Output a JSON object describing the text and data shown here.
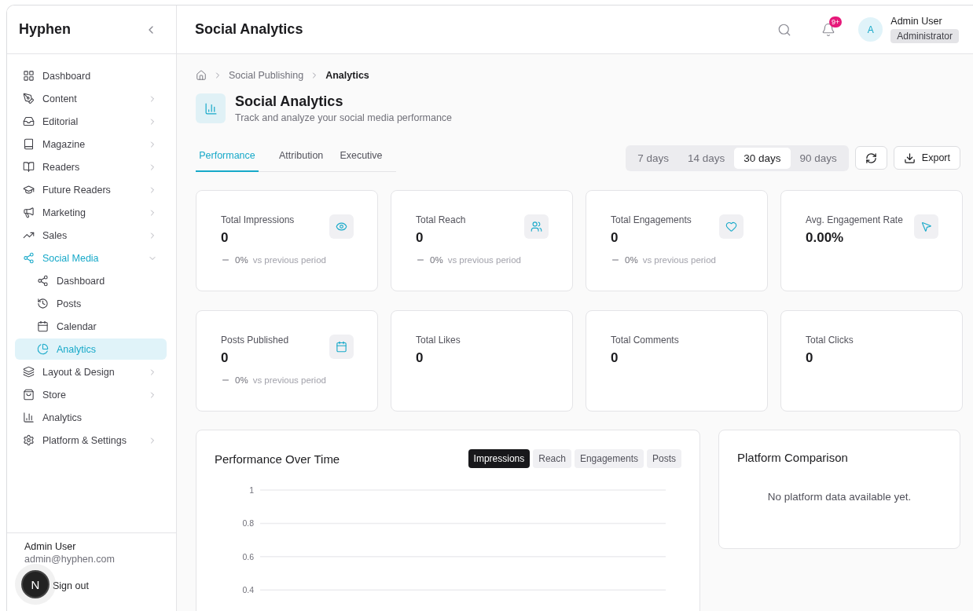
{
  "sidebar": {
    "brand": "Hyphen",
    "items": [
      {
        "label": "Dashboard",
        "expandable": false,
        "selected": false
      },
      {
        "label": "Content",
        "expandable": true,
        "expanded": false,
        "selected": false
      },
      {
        "label": "Editorial",
        "expandable": true,
        "expanded": false,
        "selected": false
      },
      {
        "label": "Magazine",
        "expandable": true,
        "expanded": false,
        "selected": false
      },
      {
        "label": "Readers",
        "expandable": true,
        "expanded": false,
        "selected": false
      },
      {
        "label": "Future Readers",
        "expandable": true,
        "expanded": false,
        "selected": false
      },
      {
        "label": "Marketing",
        "expandable": true,
        "expanded": false,
        "selected": false
      },
      {
        "label": "Sales",
        "expandable": true,
        "expanded": false,
        "selected": false
      },
      {
        "label": "Social Media",
        "expandable": true,
        "expanded": true,
        "selected": false,
        "children": [
          {
            "label": "Dashboard",
            "selected": false
          },
          {
            "label": "Posts",
            "selected": false
          },
          {
            "label": "Calendar",
            "selected": false
          },
          {
            "label": "Analytics",
            "selected": true
          }
        ]
      },
      {
        "label": "Layout & Design",
        "expandable": true,
        "expanded": false,
        "selected": false
      },
      {
        "label": "Store",
        "expandable": true,
        "expanded": false,
        "selected": false
      },
      {
        "label": "Analytics",
        "expandable": false,
        "selected": false
      },
      {
        "label": "Platform & Settings",
        "expandable": true,
        "expanded": false,
        "selected": false
      }
    ],
    "user": {
      "name": "Admin User",
      "email": "admin@hyphen.com",
      "sign_out": "Sign out"
    }
  },
  "dev_badge": {
    "label": "N"
  },
  "header": {
    "title": "Social Analytics",
    "notification_badge": "9+",
    "avatar": "A",
    "user_name": "Admin User",
    "role": "Administrator"
  },
  "breadcrumbs": [
    "Social Publishing",
    "Analytics"
  ],
  "page": {
    "title": "Social Analytics",
    "subtitle": "Track and analyze your social media performance"
  },
  "tabs": [
    {
      "label": "Performance",
      "selected": true
    },
    {
      "label": "Attribution",
      "selected": false
    },
    {
      "label": "Executive",
      "selected": false
    }
  ],
  "ranges": [
    {
      "label": "7 days",
      "selected": false
    },
    {
      "label": "14 days",
      "selected": false
    },
    {
      "label": "30 days",
      "selected": true
    },
    {
      "label": "90 days",
      "selected": false
    }
  ],
  "export_label": "Export",
  "metrics": [
    {
      "label": "Total Impressions",
      "value": "0",
      "change": "0%",
      "comparison": "vs previous period"
    },
    {
      "label": "Total Reach",
      "value": "0",
      "change": "0%",
      "comparison": "vs previous period"
    },
    {
      "label": "Total Engagements",
      "value": "0",
      "change": "0%",
      "comparison": "vs previous period"
    },
    {
      "label": "Avg. Engagement Rate",
      "value": "0.00%"
    },
    {
      "label": "Posts Published",
      "value": "0",
      "change": "0%",
      "comparison": "vs previous period"
    },
    {
      "label": "Total Likes",
      "value": "0"
    },
    {
      "label": "Total Comments",
      "value": "0"
    },
    {
      "label": "Total Clicks",
      "value": "0"
    }
  ],
  "performance": {
    "title": "Performance Over Time",
    "toggles": [
      {
        "label": "Impressions",
        "selected": true
      },
      {
        "label": "Reach",
        "selected": false
      },
      {
        "label": "Engagements",
        "selected": false
      },
      {
        "label": "Posts",
        "selected": false
      }
    ],
    "axis_labels": [
      "1",
      "0.8",
      "0.6",
      "0.4"
    ]
  },
  "platform": {
    "title": "Platform Comparison",
    "empty_text": "No platform data available yet."
  }
}
